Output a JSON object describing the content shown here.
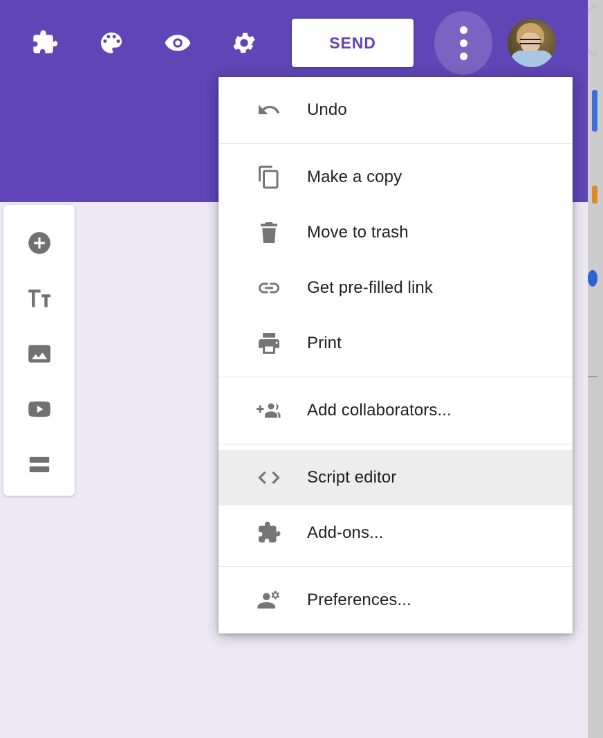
{
  "theme": {
    "header_purple": "#5f45b5",
    "page_background": "#ece9f5",
    "menu_background": "#ffffff",
    "menu_hover_background": "#ededed",
    "menu_text": "#212121",
    "menu_icon": "#757575",
    "send_button_text": "#5f45b5"
  },
  "header": {
    "toolbar_icons": [
      {
        "name": "puzzle-icon",
        "label": "Add-ons"
      },
      {
        "name": "palette-icon",
        "label": "Customize theme"
      },
      {
        "name": "eye-icon",
        "label": "Preview"
      },
      {
        "name": "gear-icon",
        "label": "Settings"
      }
    ],
    "send_label": "SEND",
    "more_button_label": "More",
    "avatar_label": "Account"
  },
  "insert_sidebar": {
    "items": [
      {
        "name": "add-question-icon",
        "label": "Add question"
      },
      {
        "name": "add-title-icon",
        "label": "Add title and description"
      },
      {
        "name": "add-image-icon",
        "label": "Add image"
      },
      {
        "name": "add-video-icon",
        "label": "Add video"
      },
      {
        "name": "add-section-icon",
        "label": "Add section"
      }
    ]
  },
  "more_menu": {
    "groups": [
      {
        "items": [
          {
            "icon": "undo-icon",
            "label": "Undo",
            "active": false
          }
        ]
      },
      {
        "items": [
          {
            "icon": "copy-icon",
            "label": "Make a copy",
            "active": false
          },
          {
            "icon": "trash-icon",
            "label": "Move to trash",
            "active": false
          },
          {
            "icon": "link-icon",
            "label": "Get pre-filled link",
            "active": false
          },
          {
            "icon": "print-icon",
            "label": "Print",
            "active": false
          }
        ]
      },
      {
        "items": [
          {
            "icon": "add-collaborators-icon",
            "label": "Add collaborators...",
            "active": false
          }
        ]
      },
      {
        "items": [
          {
            "icon": "code-brackets-icon",
            "label": "Script editor",
            "active": true
          },
          {
            "icon": "puzzle-icon",
            "label": "Add-ons...",
            "active": false
          }
        ]
      },
      {
        "items": [
          {
            "icon": "person-settings-icon",
            "label": "Preferences...",
            "active": false
          }
        ]
      }
    ]
  }
}
